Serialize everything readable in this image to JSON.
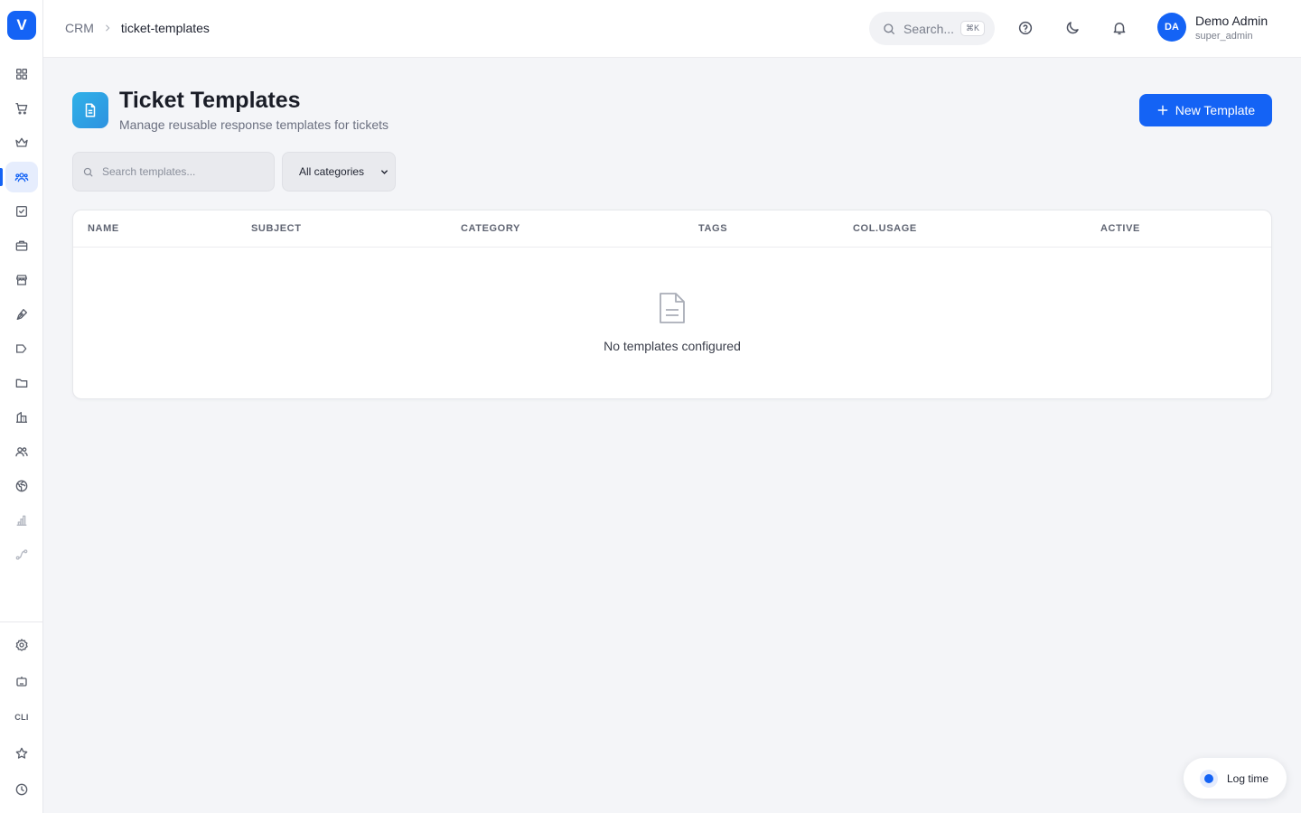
{
  "app": {
    "logo_letter": "V",
    "accent_color": "#1463f5"
  },
  "sidebar": {
    "items": [
      {
        "icon": "grid-icon"
      },
      {
        "icon": "cart-icon"
      },
      {
        "icon": "crown-icon"
      },
      {
        "icon": "users-icon",
        "active": true
      },
      {
        "icon": "checkbox-icon"
      },
      {
        "icon": "briefcase-icon"
      },
      {
        "icon": "store-icon"
      },
      {
        "icon": "pen-tool-icon"
      },
      {
        "icon": "megaphone-icon"
      },
      {
        "icon": "folder-icon"
      },
      {
        "icon": "building-icon"
      },
      {
        "icon": "team-icon"
      },
      {
        "icon": "globe-icon"
      },
      {
        "icon": "bar-chart-icon"
      },
      {
        "icon": "route-icon"
      }
    ],
    "bottom_items": [
      {
        "icon": "settings-icon"
      },
      {
        "icon": "bot-icon"
      },
      {
        "icon": "cli-icon",
        "label": "CLI"
      },
      {
        "icon": "star-icon"
      },
      {
        "icon": "clock-icon"
      }
    ]
  },
  "topbar": {
    "breadcrumb": {
      "root": "CRM",
      "current": "ticket-templates"
    },
    "search": {
      "label": "Search...",
      "shortcut": "⌘K"
    },
    "user": {
      "initials": "DA",
      "name": "Demo Admin",
      "role": "super_admin"
    }
  },
  "page": {
    "title": "Ticket Templates",
    "subtitle": "Manage reusable response templates for tickets",
    "new_button_label": "New Template"
  },
  "filters": {
    "search_placeholder": "Search templates...",
    "category_selected": "All categories"
  },
  "table": {
    "columns": [
      "NAME",
      "SUBJECT",
      "CATEGORY",
      "TAGS",
      "COL.USAGE",
      "ACTIVE"
    ],
    "empty_message": "No templates configured"
  },
  "log_time": {
    "label": "Log time"
  }
}
